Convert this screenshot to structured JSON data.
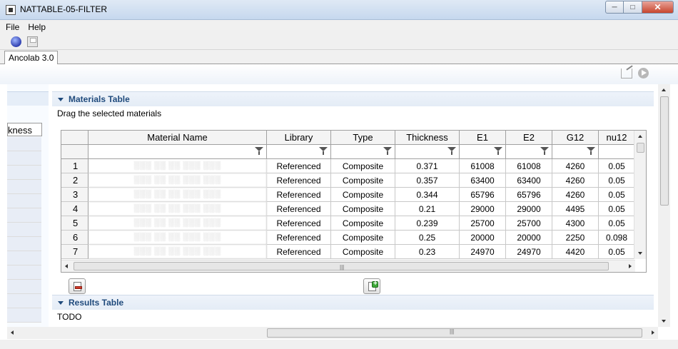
{
  "window": {
    "title": "NATTABLE-05-FILTER"
  },
  "menu": {
    "items": [
      "File",
      "Help"
    ]
  },
  "toolbar": {
    "icons": [
      "globe-icon",
      "save-icon"
    ]
  },
  "tab": {
    "label": "Ancolab 3.0"
  },
  "left_panel": {
    "header": "kness"
  },
  "materials": {
    "title": "Materials Table",
    "description": "Drag the selected materials",
    "columns": [
      "Material Name",
      "Library",
      "Type",
      "Thickness",
      "E1",
      "E2",
      "G12",
      "nu12"
    ],
    "rows": [
      {
        "num": "1",
        "name": "░░░ ░░ ░░ ░░░ ░░░",
        "library": "Referenced",
        "type": "Composite",
        "thickness": "0.371",
        "e1": "61008",
        "e2": "61008",
        "g12": "4260",
        "nu12": "0.05"
      },
      {
        "num": "2",
        "name": "░░░ ░░ ░░ ░░░ ░░░",
        "library": "Referenced",
        "type": "Composite",
        "thickness": "0.357",
        "e1": "63400",
        "e2": "63400",
        "g12": "4260",
        "nu12": "0.05"
      },
      {
        "num": "3",
        "name": "░░░ ░░ ░░ ░░░ ░░░",
        "library": "Referenced",
        "type": "Composite",
        "thickness": "0.344",
        "e1": "65796",
        "e2": "65796",
        "g12": "4260",
        "nu12": "0.05"
      },
      {
        "num": "4",
        "name": "░░░ ░░ ░░ ░░░ ░░░",
        "library": "Referenced",
        "type": "Composite",
        "thickness": "0.21",
        "e1": "29000",
        "e2": "29000",
        "g12": "4495",
        "nu12": "0.05"
      },
      {
        "num": "5",
        "name": "░░░ ░░ ░░ ░░░ ░░░",
        "library": "Referenced",
        "type": "Composite",
        "thickness": "0.239",
        "e1": "25700",
        "e2": "25700",
        "g12": "4300",
        "nu12": "0.05"
      },
      {
        "num": "6",
        "name": "░░░ ░░ ░░ ░░░ ░░░",
        "library": "Referenced",
        "type": "Composite",
        "thickness": "0.25",
        "e1": "20000",
        "e2": "20000",
        "g12": "2250",
        "nu12": "0.098"
      },
      {
        "num": "7",
        "name": "░░░ ░░ ░░ ░░░ ░░░",
        "library": "Referenced",
        "type": "Composite",
        "thickness": "0.23",
        "e1": "24970",
        "e2": "24970",
        "g12": "4420",
        "nu12": "0.05"
      }
    ]
  },
  "results": {
    "title": "Results Table",
    "text": "TODO"
  },
  "colors": {
    "section_title": "#1f4a7c",
    "section_bg": "#e8eff8",
    "title_bar": "#c6d8ee",
    "close_button": "#c8452e"
  }
}
